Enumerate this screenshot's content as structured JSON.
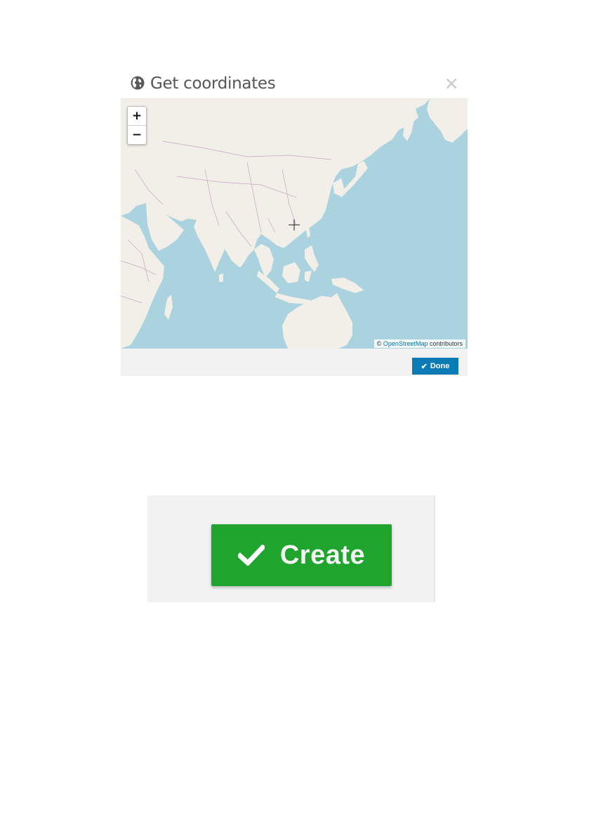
{
  "modal": {
    "title": "Get coordinates",
    "close_label": "×",
    "icon": "globe-icon",
    "zoom_in_label": "+",
    "zoom_out_label": "−",
    "attribution": {
      "prefix": "© ",
      "link": "OpenStreetMap",
      "suffix": " contributors"
    },
    "done_label": "Done"
  },
  "create": {
    "label": "Create",
    "icon": "check-icon"
  },
  "colors": {
    "water": "#aad3df",
    "land": "#f2efe9",
    "border": "#c9a3c4",
    "done_button": "#0a7bb5",
    "create_button": "#1fa52d"
  }
}
